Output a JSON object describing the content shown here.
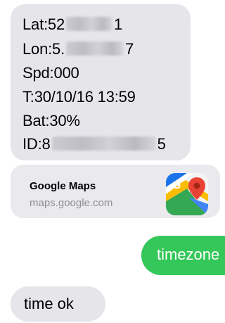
{
  "thread": {
    "gps_message": {
      "lat_label": "Lat:",
      "lat_visible": "52",
      "lat_tail": "1",
      "lon_label": "Lon:",
      "lon_visible": "5.",
      "lon_tail": "7",
      "speed": "Spd:000",
      "time": "T:30/10/16 13:59",
      "battery": "Bat:30%",
      "id_label": "ID:",
      "id_visible": "8",
      "id_tail": "5"
    },
    "link_preview": {
      "title": "Google Maps",
      "url": "maps.google.com",
      "icon": "google-maps-icon"
    },
    "outgoing": {
      "text": "timezone"
    },
    "reply": {
      "text": "time ok"
    }
  },
  "colors": {
    "incoming_bubble": "#e5e5ea",
    "outgoing_bubble": "#34c759",
    "url_gray": "#8e8e93"
  }
}
